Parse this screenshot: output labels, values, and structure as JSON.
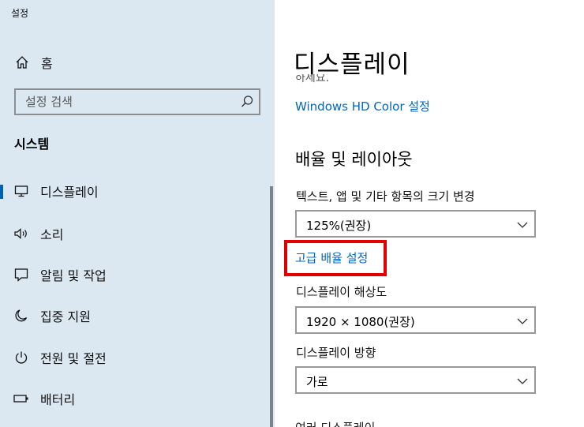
{
  "app": {
    "title": "설정"
  },
  "sidebar": {
    "home_label": "홈",
    "search_placeholder": "설정 검색",
    "section_title": "시스템",
    "items": [
      {
        "label": "디스플레이",
        "icon": "monitor-icon",
        "active": true
      },
      {
        "label": "소리",
        "icon": "speaker-icon"
      },
      {
        "label": "알림 및 작업",
        "icon": "notification-icon"
      },
      {
        "label": "집중 지원",
        "icon": "moon-icon"
      },
      {
        "label": "전원 및 절전",
        "icon": "power-icon"
      },
      {
        "label": "배터리",
        "icon": "battery-icon"
      }
    ]
  },
  "main": {
    "page_title": "디스플레이",
    "clipped_text": "하세요.",
    "hd_color_link": "Windows HD Color 설정",
    "scale_layout_heading": "배율 및 레이아웃",
    "text_size_label": "텍스트, 앱 및 기타 항목의 크기 변경",
    "scale_value": "125%(권장)",
    "advanced_scaling_link": "고급 배율 설정",
    "resolution_label": "디스플레이 해상도",
    "resolution_value": "1920 × 1080(권장)",
    "orientation_label": "디스플레이 방향",
    "orientation_value": "가로",
    "clipped_bottom_text": "여러 디스플레이"
  },
  "colors": {
    "sidebar_bg": "#dbe8f1",
    "accent": "#0063b1",
    "link": "#0067c0",
    "highlight": "#e00000"
  }
}
